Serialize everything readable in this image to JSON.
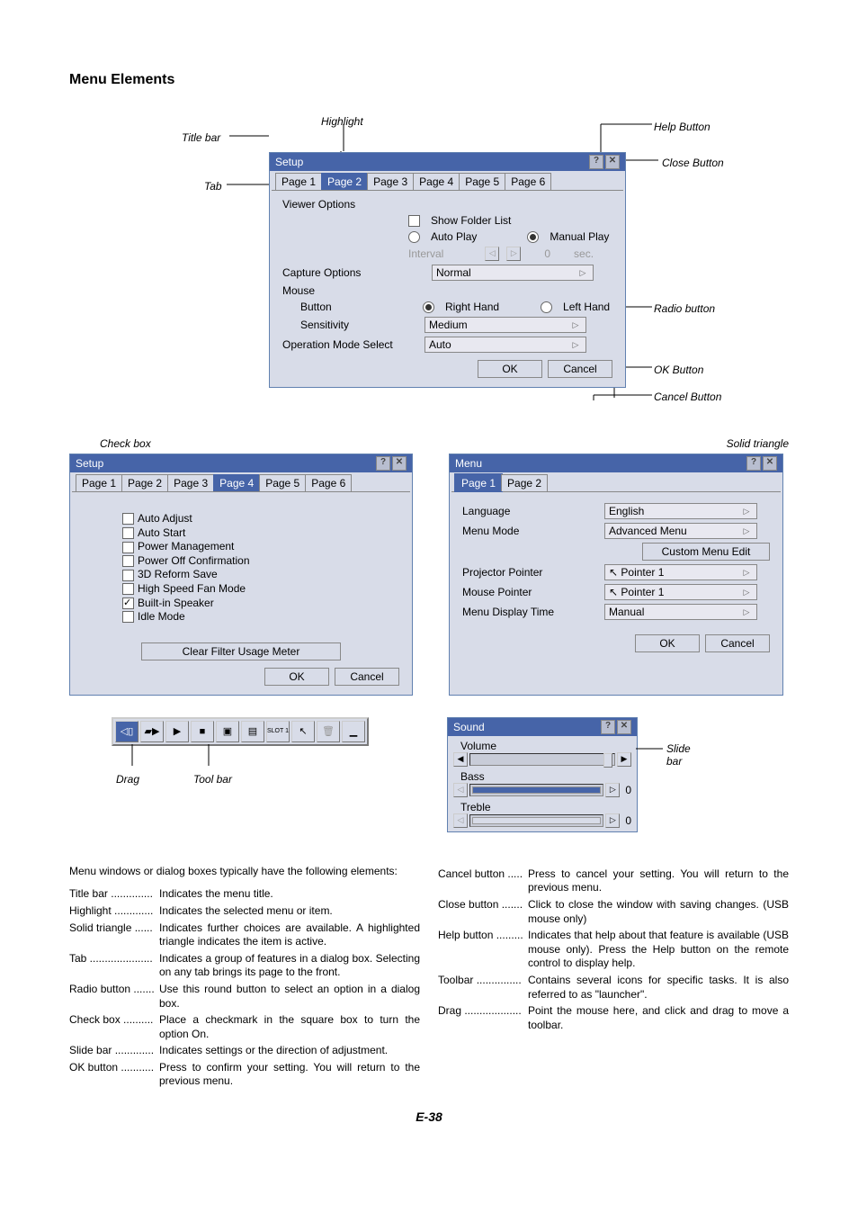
{
  "sectionTitle": "Menu Elements",
  "anno": {
    "titlebar": "Title bar",
    "highlight": "Highlight",
    "helpButton": "Help Button",
    "closeButton": "Close Button",
    "tab": "Tab",
    "radioButton": "Radio button",
    "okButton": "OK Button",
    "cancelButton": "Cancel Button",
    "checkbox": "Check box",
    "solidTriangle": "Solid triangle",
    "slidebar": "Slide bar",
    "drag": "Drag",
    "toolbar": "Tool bar"
  },
  "setup1": {
    "title": "Setup",
    "tabs": [
      "Page 1",
      "Page 2",
      "Page 3",
      "Page 4",
      "Page 5",
      "Page 6"
    ],
    "activeTab": 1,
    "viewerOptions": "Viewer Options",
    "showFolder": "Show Folder List",
    "autoPlay": "Auto Play",
    "manualPlay": "Manual Play",
    "interval": "Interval",
    "intervalVal": "0",
    "sec": "sec.",
    "captureOptions": "Capture Options",
    "captureVal": "Normal",
    "mouse": "Mouse",
    "button": "Button",
    "rightHand": "Right Hand",
    "leftHand": "Left Hand",
    "sensitivity": "Sensitivity",
    "sensitivityVal": "Medium",
    "operationMode": "Operation Mode Select",
    "operationVal": "Auto",
    "ok": "OK",
    "cancel": "Cancel"
  },
  "setup2": {
    "title": "Setup",
    "tabs": [
      "Page 1",
      "Page 2",
      "Page 3",
      "Page 4",
      "Page 5",
      "Page 6"
    ],
    "activeTab": 3,
    "items": [
      "Auto Adjust",
      "Auto Start",
      "Power Management",
      "Power Off Confirmation",
      "3D Reform Save",
      "High Speed Fan Mode",
      "Built-in Speaker",
      "Idle Mode"
    ],
    "checkedIdx": 6,
    "clearFilter": "Clear Filter Usage Meter",
    "ok": "OK",
    "cancel": "Cancel"
  },
  "menu": {
    "title": "Menu",
    "tabs": [
      "Page 1",
      "Page 2"
    ],
    "language": "Language",
    "languageVal": "English",
    "menuMode": "Menu Mode",
    "menuModeVal": "Advanced Menu",
    "customMenu": "Custom Menu Edit",
    "projPointer": "Projector Pointer",
    "projPointerVal": "Pointer 1",
    "mousePointer": "Mouse Pointer",
    "mousePointerVal": "Pointer 1",
    "menuDisplay": "Menu Display Time",
    "menuDisplayVal": "Manual",
    "ok": "OK",
    "cancel": "Cancel"
  },
  "sound": {
    "title": "Sound",
    "volume": "Volume",
    "bass": "Bass",
    "treble": "Treble",
    "zero": "0"
  },
  "slot": "SLOT\n1",
  "intro": "Menu windows or dialog boxes typically have the following elements:",
  "defs1": [
    {
      "term": "Title bar ..............",
      "desc": "Indicates the menu title."
    },
    {
      "term": "Highlight .............",
      "desc": "Indicates the selected menu or item."
    },
    {
      "term": "Solid triangle ......",
      "desc": "Indicates further choices are available. A highlighted triangle indicates the item is active."
    },
    {
      "term": "Tab .....................",
      "desc": "Indicates a group of features in a dialog box. Selecting on any tab brings its page to the front."
    },
    {
      "term": "Radio button .......",
      "desc": "Use this round button to select an option in a dialog box."
    },
    {
      "term": "Check box ..........",
      "desc": "Place a checkmark in the square box to turn the option On."
    },
    {
      "term": "Slide bar .............",
      "desc": "Indicates settings or the direction of adjustment."
    },
    {
      "term": "OK button ...........",
      "desc": "Press to confirm your setting. You will return to the previous menu."
    }
  ],
  "defs2": [
    {
      "term": "Cancel button .....",
      "desc": "Press to cancel your setting. You will return to the previous menu."
    },
    {
      "term": "Close button .......",
      "desc": "Click to close the window with saving changes. (USB mouse only)"
    },
    {
      "term": "Help button .........",
      "desc": "Indicates that help about that feature is available (USB mouse only). Press the Help button on the remote control to display help."
    },
    {
      "term": "Toolbar ...............",
      "desc": "Contains several icons for specific tasks. It is also referred to as \"launcher\"."
    },
    {
      "term": "Drag ...................",
      "desc": "Point the mouse here, and click and drag to move a toolbar."
    }
  ],
  "pageNum": "E-38"
}
